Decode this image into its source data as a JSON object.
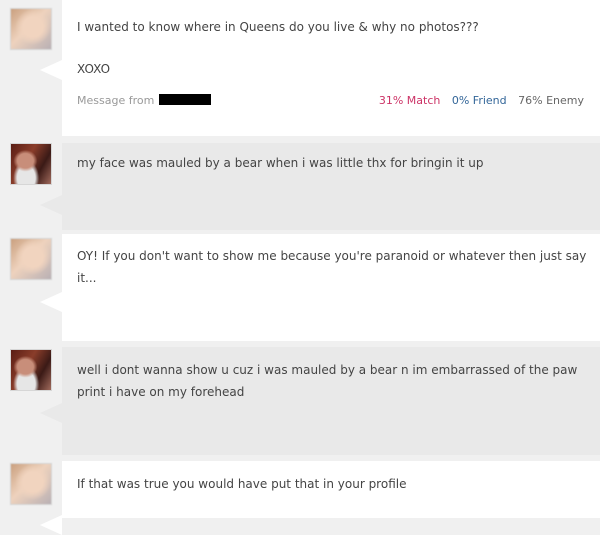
{
  "messages": [
    {
      "avatar": "blurred-user-avatar",
      "lines": [
        "I wanted to know where in Queens do you live & why no photos???",
        "XOXO"
      ],
      "meta": {
        "prefix": "Message from",
        "match": "31% Match",
        "friend": "0% Friend",
        "enemy": "76% Enemy"
      }
    },
    {
      "avatar": "bear-user-avatar",
      "lines": [
        "my face was mauled by a bear when i was little thx for bringin it up"
      ]
    },
    {
      "avatar": "blurred-user-avatar",
      "lines": [
        "OY! If you don't want to show me because you're paranoid or whatever then just say it..."
      ]
    },
    {
      "avatar": "bear-user-avatar",
      "lines": [
        "well i dont wanna show u cuz i was mauled by a bear n im embarrassed of the paw print i have on my forehead"
      ]
    },
    {
      "avatar": "blurred-user-avatar",
      "lines": [
        "If that was true you would have put that in your profile"
      ]
    }
  ],
  "colors": {
    "match": "#cc3366",
    "friend": "#336699",
    "enemy": "#666666"
  }
}
